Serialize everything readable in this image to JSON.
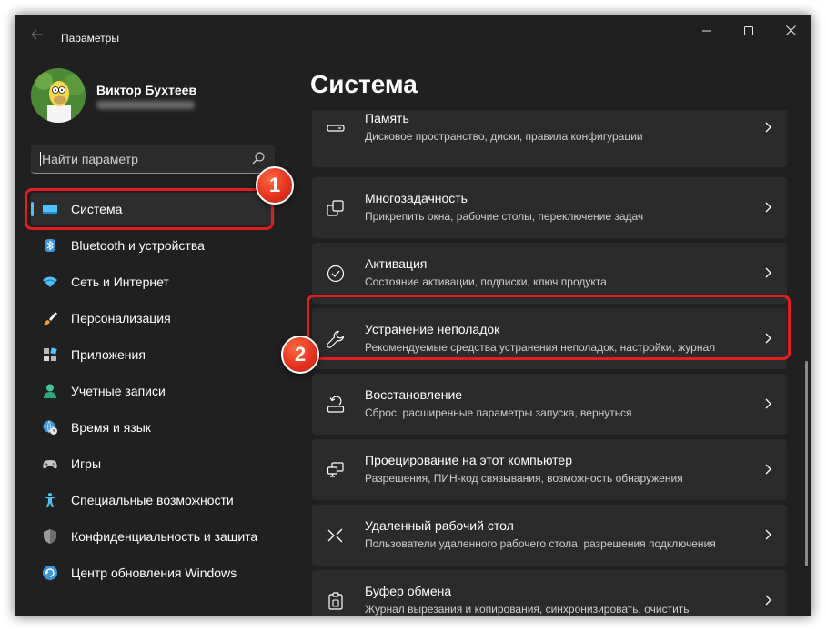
{
  "titlebar": {
    "app_title": "Параметры",
    "back_icon": "arrow-left-icon",
    "minimize_icon": "minimize-icon",
    "maximize_icon": "maximize-icon",
    "close_icon": "close-icon"
  },
  "user": {
    "name": "Виктор Бухтеев",
    "email_blurred": "•••••••••••••••"
  },
  "search": {
    "placeholder": "Найти параметр",
    "icon": "search-icon"
  },
  "sidebar": {
    "items": [
      {
        "label": "Система",
        "icon": "monitor-icon",
        "active": true
      },
      {
        "label": "Bluetooth и устройства",
        "icon": "bluetooth-icon"
      },
      {
        "label": "Сеть и Интернет",
        "icon": "wifi-icon"
      },
      {
        "label": "Персонализация",
        "icon": "brush-icon"
      },
      {
        "label": "Приложения",
        "icon": "apps-icon"
      },
      {
        "label": "Учетные записи",
        "icon": "person-icon"
      },
      {
        "label": "Время и язык",
        "icon": "globe-clock-icon"
      },
      {
        "label": "Игры",
        "icon": "gamepad-icon"
      },
      {
        "label": "Специальные возможности",
        "icon": "accessibility-icon"
      },
      {
        "label": "Конфиденциальность и защита",
        "icon": "shield-icon"
      },
      {
        "label": "Центр обновления Windows",
        "icon": "update-icon"
      }
    ]
  },
  "main": {
    "title": "Система",
    "cards": [
      {
        "title": "Память",
        "subtitle": "Дисковое пространство, диски, правила конфигурации",
        "icon": "storage-icon"
      },
      {
        "title": "Многозадачность",
        "subtitle": "Прикрепить окна, рабочие столы, переключение задач",
        "icon": "multitasking-icon"
      },
      {
        "title": "Активация",
        "subtitle": "Состояние активации, подписки, ключ продукта",
        "icon": "checkmark-circle-icon"
      },
      {
        "title": "Устранение неполадок",
        "subtitle": "Рекомендуемые средства устранения неполадок, настройки, журнал",
        "icon": "wrench-icon"
      },
      {
        "title": "Восстановление",
        "subtitle": "Сброс, расширенные параметры запуска, вернуться",
        "icon": "recovery-icon"
      },
      {
        "title": "Проецирование на этот компьютер",
        "subtitle": "Разрешения, ПИН-код связывания, возможность обнаружения",
        "icon": "projection-icon"
      },
      {
        "title": "Удаленный рабочий стол",
        "subtitle": "Пользователи удаленного рабочего стола, разрешения подключения",
        "icon": "remote-desktop-icon"
      },
      {
        "title": "Буфер обмена",
        "subtitle": "Журнал вырезания и копирования, синхронизировать, очистить",
        "icon": "clipboard-icon"
      }
    ]
  },
  "annotations": {
    "badge1": "1",
    "badge2": "2",
    "color": "#e31d1d"
  },
  "colors": {
    "window_bg": "#202020",
    "card_bg": "#2b2b2b",
    "accent": "#4cc2ff"
  }
}
